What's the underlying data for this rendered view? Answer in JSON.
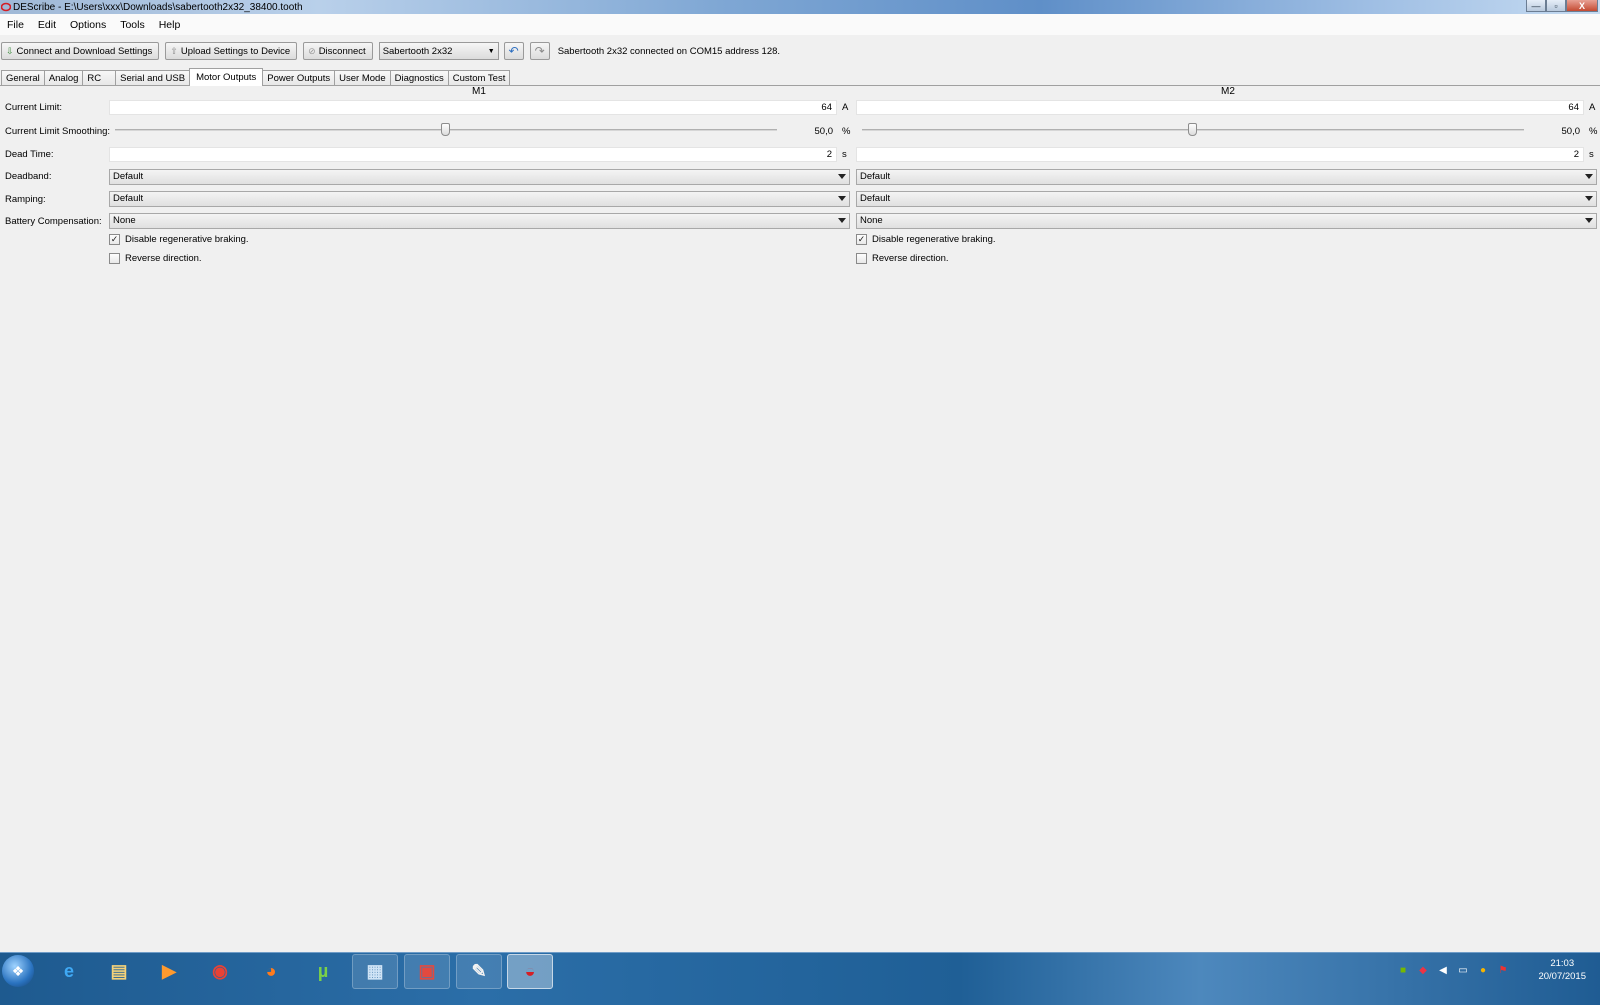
{
  "window": {
    "title": "DEScribe - E:\\Users\\xxx\\Downloads\\sabertooth2x32_38400.tooth",
    "minimize": "—",
    "maximize": "▫",
    "close": "X"
  },
  "menu": {
    "items": [
      "File",
      "Edit",
      "Options",
      "Tools",
      "Help"
    ]
  },
  "toolbar": {
    "connect_label": "Connect and Download Settings",
    "upload_label": "Upload Settings to Device",
    "disconnect_label": "Disconnect",
    "device_selected": "Sabertooth 2x32",
    "status": "Sabertooth 2x32 connected on COM15 address 128."
  },
  "tabs": {
    "items": [
      "General",
      "Analog",
      "RC",
      "Serial and USB",
      "Motor Outputs",
      "Power Outputs",
      "User Mode",
      "Diagnostics",
      "Custom Test"
    ],
    "active": "Motor Outputs"
  },
  "motor": {
    "labels": {
      "current_limit": "Current Limit:",
      "smoothing": "Current Limit Smoothing:",
      "dead_time": "Dead Time:",
      "deadband": "Deadband:",
      "ramping": "Ramping:",
      "battery": "Battery Compensation:"
    },
    "m1": {
      "header": "M1",
      "current_limit": "64",
      "current_unit": "A",
      "smoothing_value": "50,0",
      "smoothing_fraction": 0.5,
      "smoothing_unit": "%",
      "dead_time": "2",
      "dead_time_unit": "s",
      "deadband": "Default",
      "ramping": "Default",
      "battery": "None",
      "regen_label": "Disable regenerative braking.",
      "regen_checked": true,
      "reverse_label": "Reverse direction.",
      "reverse_checked": false
    },
    "m2": {
      "header": "M2",
      "current_limit": "64",
      "current_unit": "A",
      "smoothing_value": "50,0",
      "smoothing_fraction": 0.5,
      "smoothing_unit": "%",
      "dead_time": "2",
      "dead_time_unit": "s",
      "deadband": "Default",
      "ramping": "Default",
      "battery": "None",
      "regen_label": "Disable regenerative braking.",
      "regen_checked": true,
      "reverse_label": "Reverse direction.",
      "reverse_checked": false
    }
  },
  "taskbar": {
    "apps": [
      {
        "icon": "internet-explorer-icon",
        "glyph": "e",
        "color": "#3fa9f5"
      },
      {
        "icon": "file-explorer-icon",
        "glyph": "▤",
        "color": "#f4d27a"
      },
      {
        "icon": "media-player-icon",
        "glyph": "▶",
        "color": "#ff9a2e"
      },
      {
        "icon": "chrome-icon",
        "glyph": "◉",
        "color": "#e94235"
      },
      {
        "icon": "firefox-icon",
        "glyph": "◕",
        "color": "#ff7b1c"
      },
      {
        "icon": "utorrent-icon",
        "glyph": "µ",
        "color": "#7bd148"
      },
      {
        "icon": "remote-desktop-icon",
        "glyph": "▦",
        "color": "#cfe3f5"
      },
      {
        "icon": "toolbox-icon",
        "glyph": "▣",
        "color": "#e2493f"
      },
      {
        "icon": "paint-icon",
        "glyph": "✎",
        "color": "#f2f2f2"
      },
      {
        "icon": "describe-app-icon",
        "glyph": "◒",
        "color": "#d41f26"
      }
    ],
    "clock_time": "21:03",
    "clock_date": "20/07/2015"
  },
  "colors": {
    "accent": "#1f5f96",
    "status_red": "#d41f26"
  }
}
